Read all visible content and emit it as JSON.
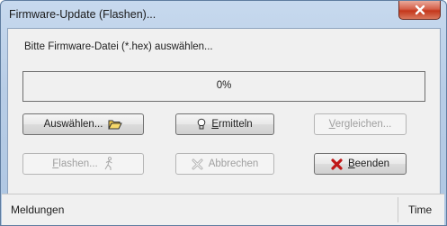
{
  "window": {
    "title": "Firmware-Update (Flashen)..."
  },
  "prompt": "Bitte Firmware-Datei (*.hex) auswählen...",
  "progress": {
    "text": "0%",
    "value": 0
  },
  "buttons": {
    "select": {
      "pre": "Auswählen...",
      "icon": "folder-icon"
    },
    "detect": {
      "hot": "E",
      "rest": "rmitteln",
      "icon": "lightbulb-icon"
    },
    "compare": {
      "hot": "V",
      "rest": "ergleichen..."
    },
    "flash": {
      "hot": "F",
      "rest": "lashen...",
      "icon": "running-man-icon"
    },
    "abort": {
      "label": "Abbrechen",
      "icon": "cross-icon"
    },
    "exit": {
      "hot": "B",
      "rest": "eenden",
      "icon": "red-x-icon"
    }
  },
  "status": {
    "left": "Meldungen",
    "right": "Time"
  },
  "colors": {
    "accent_red": "#c4371b",
    "progress_green": "#3fb93f",
    "exit_x": "#c01818"
  }
}
